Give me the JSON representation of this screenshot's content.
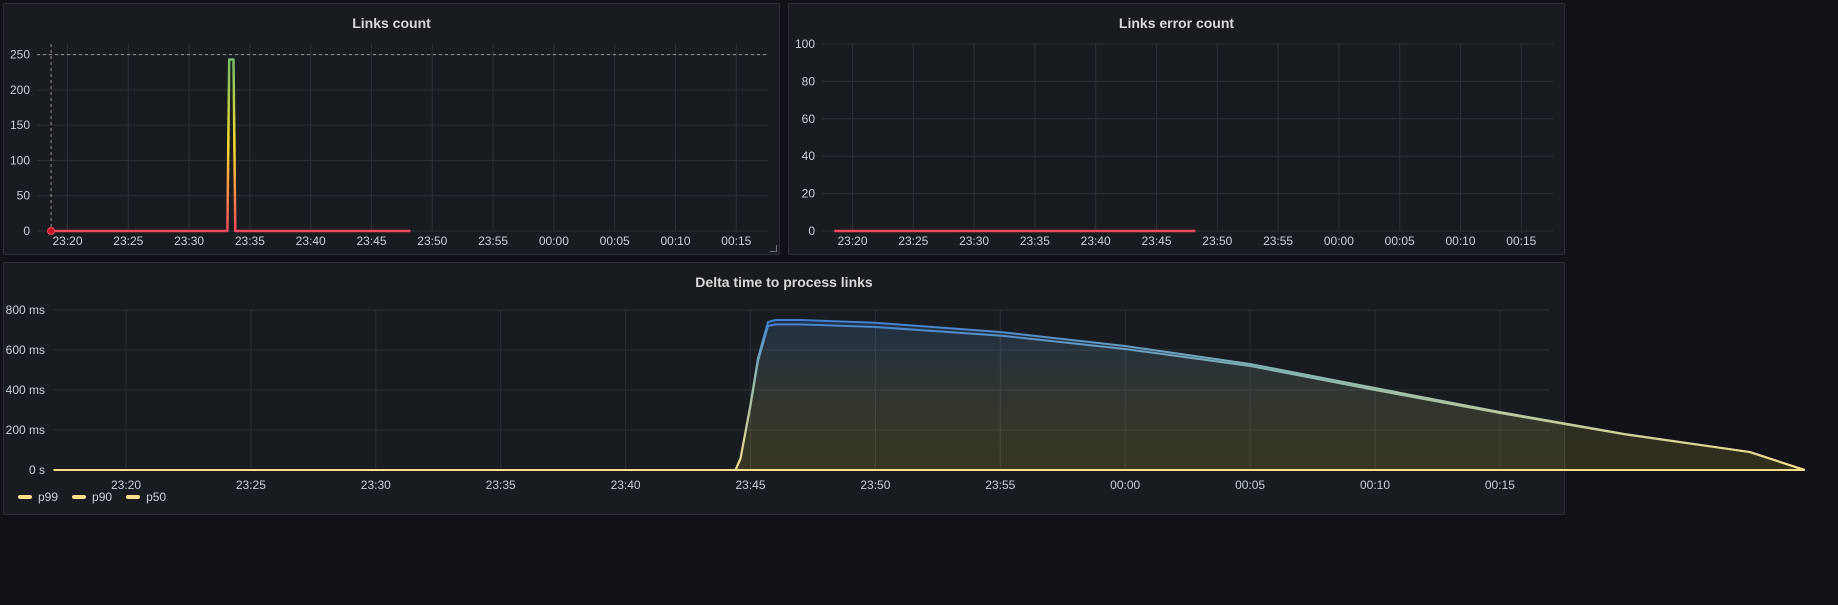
{
  "panels": {
    "links_count": {
      "title": "Links count"
    },
    "links_error_count": {
      "title": "Links error count"
    },
    "delta_time": {
      "title": "Delta time to process links",
      "legend": [
        {
          "name": "p99",
          "color": "#fade8c"
        },
        {
          "name": "p90",
          "color": "#fade8c"
        },
        {
          "name": "p50",
          "color": "#fade8c"
        }
      ]
    }
  },
  "colors": {
    "threshold_red": "#f2495c",
    "green": "#73bf69",
    "yellow": "#fade2a",
    "blue": "#3274d9",
    "grid": "#2c3036"
  },
  "chart_data": [
    {
      "id": "links_count",
      "type": "line",
      "title": "Links count",
      "x_ticks": [
        "23:20",
        "23:25",
        "23:30",
        "23:35",
        "23:40",
        "23:45",
        "23:50",
        "23:55",
        "00:00",
        "00:05",
        "00:10",
        "00:15"
      ],
      "y_ticks": [
        "0",
        "50",
        "100",
        "150",
        "200",
        "250"
      ],
      "ylim": [
        0,
        265
      ],
      "x_range_minutes": [
        -1.5,
        28.2
      ],
      "series": [
        {
          "values": [
            [
              -1.5,
              0
            ],
            [
              13.0,
              0
            ],
            [
              13.15,
              0
            ],
            [
              13.3,
              243
            ],
            [
              13.65,
              243
            ],
            [
              13.8,
              0
            ],
            [
              28.2,
              0
            ]
          ]
        }
      ],
      "annotations": [
        "dashed horizontal line at 250",
        "dashed vertical marker near 23:20"
      ]
    },
    {
      "id": "links_error_count",
      "type": "line",
      "title": "Links error count",
      "x_ticks": [
        "23:20",
        "23:25",
        "23:30",
        "23:35",
        "23:40",
        "23:45",
        "23:50",
        "23:55",
        "00:00",
        "00:05",
        "00:10",
        "00:15"
      ],
      "y_ticks": [
        "0",
        "20",
        "40",
        "60",
        "80",
        "100"
      ],
      "ylim": [
        0,
        100
      ],
      "x_range_minutes": [
        -1.5,
        28.2
      ],
      "series": [
        {
          "values": [
            [
              -1.5,
              0
            ],
            [
              28.2,
              0
            ]
          ]
        }
      ]
    },
    {
      "id": "delta_time",
      "type": "area",
      "title": "Delta time to process links",
      "x_ticks": [
        "23:20",
        "23:25",
        "23:30",
        "23:35",
        "23:40",
        "23:45",
        "23:50",
        "23:55",
        "00:00",
        "00:05",
        "00:10",
        "00:15"
      ],
      "y_ticks": [
        "0 s",
        "200 ms",
        "400 ms",
        "600 ms",
        "800 ms"
      ],
      "ylim": [
        0,
        800
      ],
      "x_range_minutes": [
        -2.9,
        27.2
      ],
      "series": [
        {
          "name": "p99",
          "values": [
            [
              -2.9,
              0
            ],
            [
              24.4,
              0
            ],
            [
              24.6,
              60
            ],
            [
              25.0,
              330
            ],
            [
              25.3,
              560
            ],
            [
              25.7,
              740
            ],
            [
              26.0,
              750
            ],
            [
              27.0,
              750
            ],
            [
              30,
              736
            ],
            [
              35,
              690
            ],
            [
              40,
              620
            ],
            [
              45,
              530
            ],
            [
              50,
              410
            ],
            [
              55,
              290
            ],
            [
              60,
              180
            ],
            [
              65,
              90
            ],
            [
              67.2,
              0
            ]
          ]
        },
        {
          "name": "p90",
          "values": [
            [
              -2.9,
              0
            ],
            [
              24.4,
              0
            ],
            [
              24.6,
              55
            ],
            [
              25.0,
              320
            ],
            [
              25.3,
              545
            ],
            [
              25.7,
              720
            ],
            [
              26.0,
              728
            ],
            [
              27.0,
              728
            ],
            [
              30,
              715
            ],
            [
              35,
              672
            ],
            [
              40,
              605
            ],
            [
              45,
              520
            ],
            [
              50,
              400
            ],
            [
              55,
              285
            ],
            [
              60,
              178
            ],
            [
              65,
              90
            ],
            [
              67.2,
              0
            ]
          ]
        },
        {
          "name": "p50",
          "values": [
            [
              -2.9,
              0
            ],
            [
              67.2,
              0
            ]
          ]
        }
      ]
    }
  ]
}
